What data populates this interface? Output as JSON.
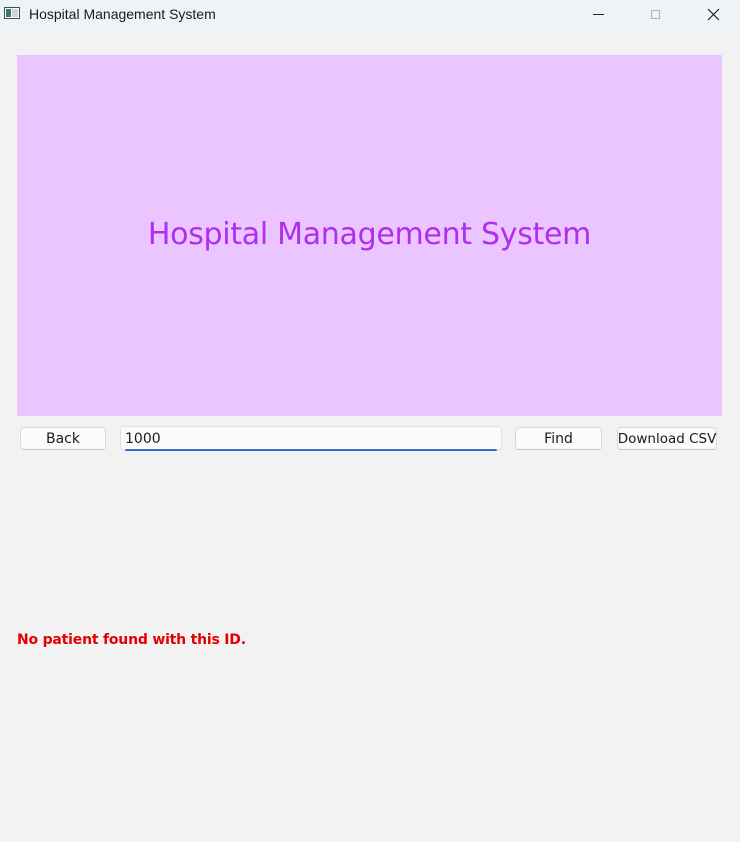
{
  "window": {
    "title": "Hospital Management System",
    "icon": "app-window-icon",
    "controls": {
      "minimize_icon": "minimize-icon",
      "maximize_icon": "maximize-icon",
      "close_icon": "close-icon"
    }
  },
  "banner": {
    "title": "Hospital Management System",
    "background_color": "#eac5ff",
    "text_color": "#b12df0"
  },
  "toolbar": {
    "back_label": "Back",
    "patient_id_value": "1000",
    "find_label": "Find",
    "download_label": "Download CSV",
    "focus_color": "#2a72c8"
  },
  "status": {
    "message": "No patient found with this ID.",
    "color": "#e60000"
  }
}
